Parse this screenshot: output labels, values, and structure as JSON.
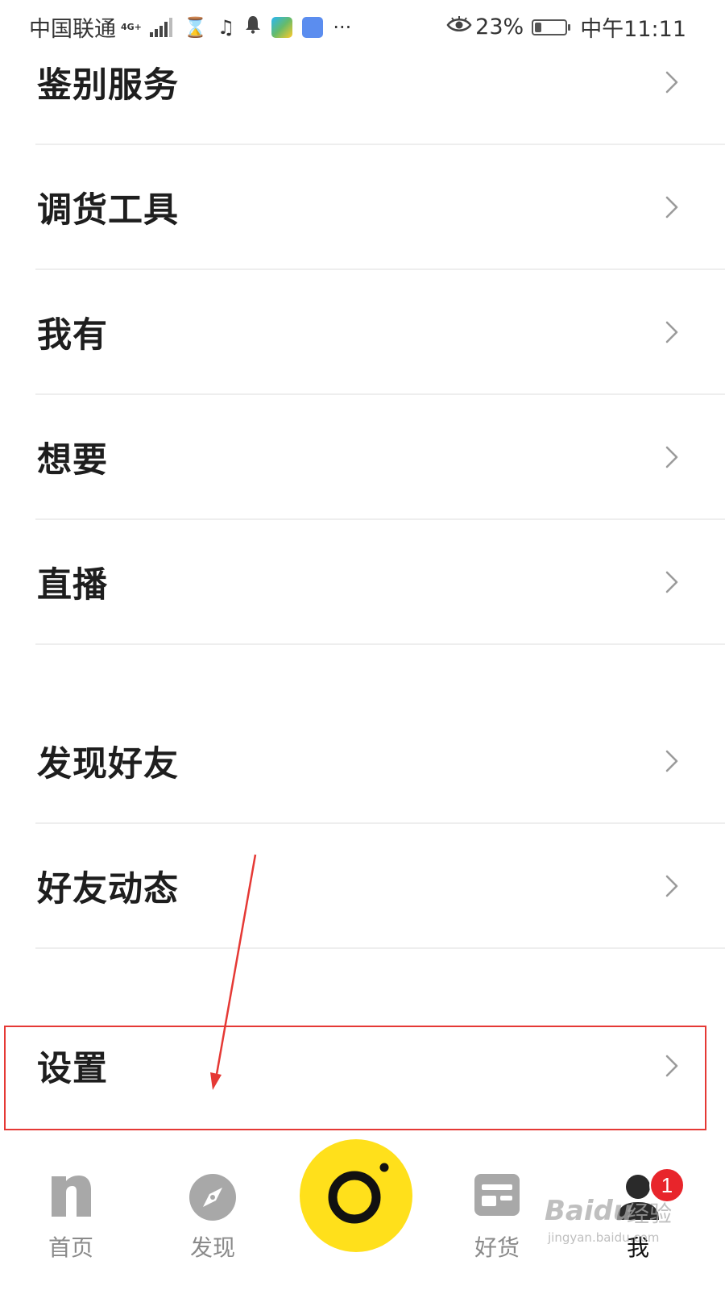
{
  "status_bar": {
    "carrier": "中国联通",
    "network": "4G+",
    "more": "···",
    "battery_percent": "23%",
    "battery_level": 0.23,
    "time": "中午11:11",
    "icons": [
      "signal-icon",
      "hourglass-icon",
      "music-note-icon",
      "bell-icon",
      "video-app-icon",
      "vue-app-icon",
      "eye-icon",
      "battery-icon"
    ]
  },
  "menu": {
    "items": [
      {
        "label": "鉴别服务"
      },
      {
        "label": "调货工具"
      },
      {
        "label": "我有"
      },
      {
        "label": "想要"
      },
      {
        "label": "直播"
      },
      {
        "label": "发现好友"
      },
      {
        "label": "好友动态"
      },
      {
        "label": "设置"
      }
    ]
  },
  "bottom_nav": {
    "tabs": [
      {
        "label": "首页",
        "icon": "home-n-icon"
      },
      {
        "label": "发现",
        "icon": "compass-icon"
      },
      {
        "label": "",
        "icon": "camera-icon"
      },
      {
        "label": "好货",
        "icon": "goods-card-icon"
      },
      {
        "label": "我",
        "icon": "profile-icon"
      }
    ],
    "active_tab": "我",
    "profile_badge": "1"
  },
  "watermark": {
    "brand": "Baidu",
    "brand_cn": "经验",
    "url": "jingyan.baidu.com"
  },
  "colors": {
    "accent_yellow": "#ffe01b",
    "badge_red": "#e8252b",
    "annotation_red": "#e53935",
    "text_dark": "#1e1e1e",
    "text_gray": "#8a8a8a"
  }
}
